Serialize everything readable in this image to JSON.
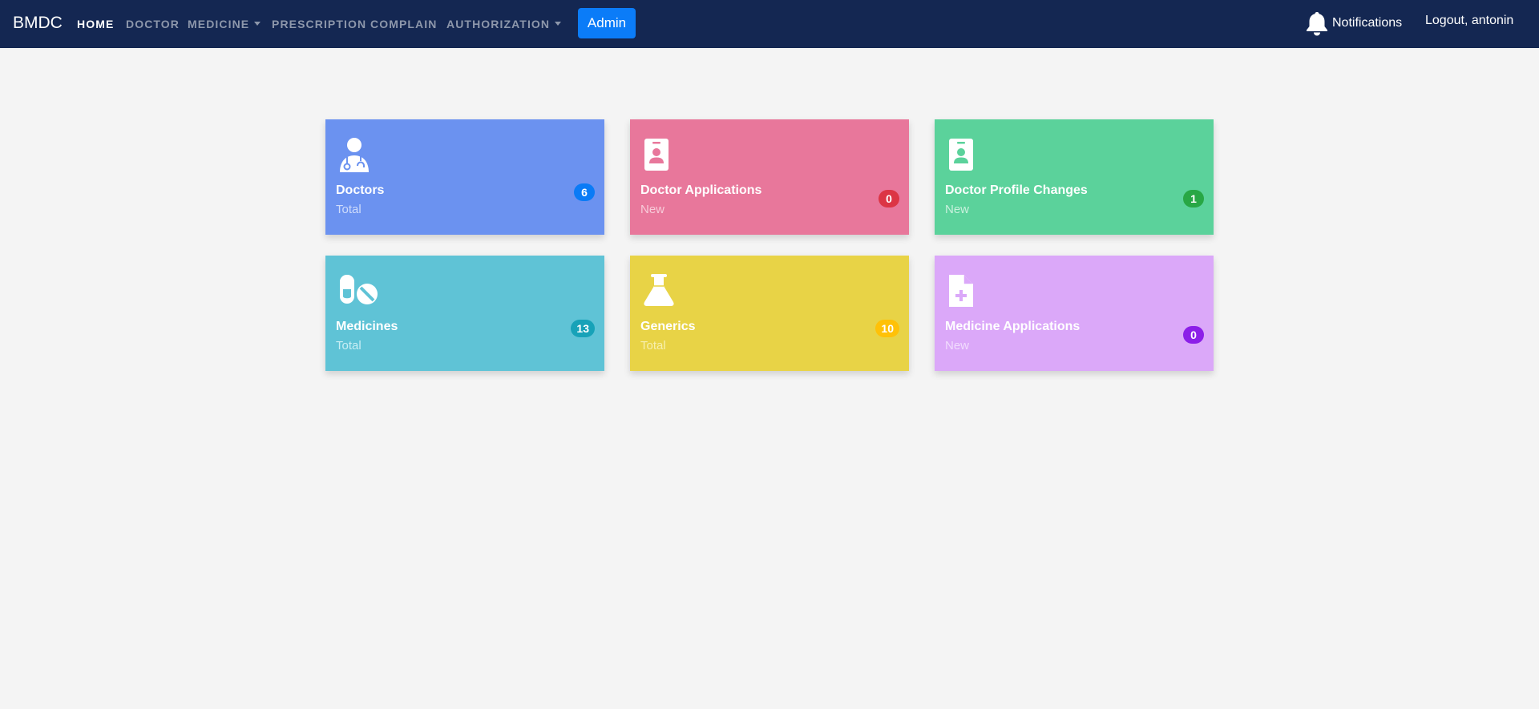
{
  "navbar": {
    "brand": "BMDC",
    "links": [
      {
        "label": "HOME"
      },
      {
        "label": "DOCTOR"
      },
      {
        "label": "MEDICINE"
      },
      {
        "label": "PRESCRIPTION"
      },
      {
        "label": "COMPLAIN"
      },
      {
        "label": "AUTHORIZATION"
      }
    ],
    "admin_label": "Admin",
    "notifications_label": "Notifications",
    "logout_label": "Logout, antonin"
  },
  "cards": [
    {
      "title": "Doctors",
      "subtitle": "Total",
      "count": "6",
      "icon": "doctor-icon",
      "bg": "#6b92f0",
      "sub_color": "#cfdcfb",
      "badge_color": "#0a7bf6"
    },
    {
      "title": "Doctor Applications",
      "subtitle": "New",
      "count": "0",
      "icon": "id-badge-icon",
      "bg": "#e8779b",
      "sub_color": "#f7cbd9",
      "badge_color": "#dc3545"
    },
    {
      "title": "Doctor Profile Changes",
      "subtitle": "New",
      "count": "1",
      "icon": "id-badge-icon",
      "bg": "#5bd29b",
      "sub_color": "#c9f1dd",
      "badge_color": "#28a745"
    },
    {
      "title": "Medicines",
      "subtitle": "Total",
      "count": "13",
      "icon": "pills-icon",
      "bg": "#5fc3d6",
      "sub_color": "#c9eef4",
      "badge_color": "#17a2b8"
    },
    {
      "title": "Generics",
      "subtitle": "Total",
      "count": "10",
      "icon": "flask-icon",
      "bg": "#e8d346",
      "sub_color": "#f7efae",
      "badge_color": "#ffc107"
    },
    {
      "title": "Medicine Applications",
      "subtitle": "New",
      "count": "0",
      "icon": "file-medical-icon",
      "bg": "#dba8f9",
      "sub_color": "#f1dcfd",
      "badge_color": "#8c1fe8"
    }
  ]
}
